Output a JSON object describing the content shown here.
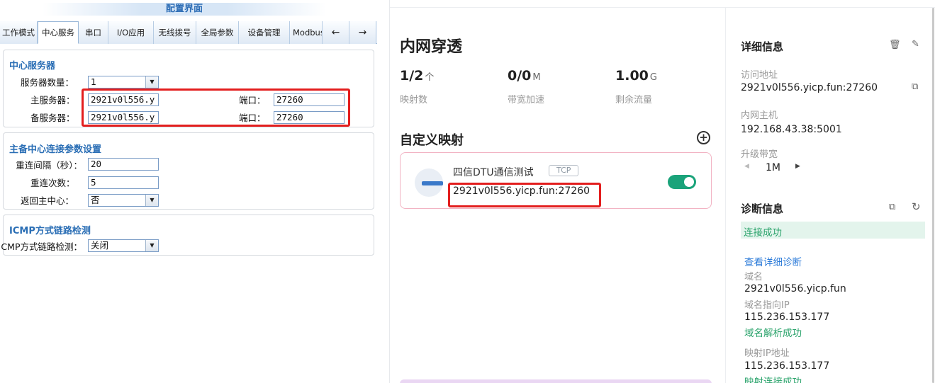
{
  "config": {
    "title": "配置界面",
    "tabs": [
      "工作模式",
      "中心服务",
      "串口",
      "I/O应用",
      "无线拨号",
      "全局参数",
      "设备管理",
      "Modbus"
    ],
    "tab_prev": "←",
    "tab_next": "→",
    "center": {
      "title": "中心服务器",
      "server_count_label": "服务器数量：",
      "server_count_value": "1",
      "main_label": "主服务器：",
      "main_value": "2921v0l556.y",
      "main_port_label": "端口：",
      "main_port_value": "27260",
      "backup_label": "备服务器：",
      "backup_value": "2921v0l556.y",
      "backup_port_label": "端口：",
      "backup_port_value": "27260"
    },
    "conn": {
      "title": "主备中心连接参数设置",
      "interval_label": "重连间隔（秒）：",
      "interval_value": "20",
      "retry_label": "重连次数：",
      "retry_value": "5",
      "return_label": "返回主中心：",
      "return_value": "否"
    },
    "icmp": {
      "title": "ICMP方式链路检测",
      "detect_label": "ICMP方式链路检测：",
      "detect_value": "关闭"
    }
  },
  "app": {
    "title": "内网穿透",
    "stats": [
      {
        "value": "1/2",
        "unit": "个",
        "label": "映射数"
      },
      {
        "value": "0/0",
        "unit": "M",
        "label": "带宽加速"
      },
      {
        "value": "1.00",
        "unit": "G",
        "label": "剩余流量"
      }
    ],
    "custom_title": "自定义映射",
    "card": {
      "name": "四信DTU通信测试",
      "badge": "TCP",
      "address": "2921v0l556.yicp.fun:27260"
    },
    "detail": {
      "title": "详细信息",
      "access_label": "访问地址",
      "access_value": "2921v0l556.yicp.fun:27260",
      "host_label": "内网主机",
      "host_value": "192.168.43.38:5001",
      "bw_label": "升级带宽",
      "bw_value": "1M"
    },
    "diag": {
      "title": "诊断信息",
      "status": "连接成功",
      "link": "查看详细诊断",
      "domain_label": "域名",
      "domain_value": "2921v0l556.yicp.fun",
      "ip_label": "域名指向IP",
      "ip_value": "115.236.153.177",
      "resolve_ok": "域名解析成功",
      "map_ip_label": "映射IP地址",
      "map_ip_value": "115.236.153.177",
      "map_ok": "映射连接成功"
    }
  }
}
